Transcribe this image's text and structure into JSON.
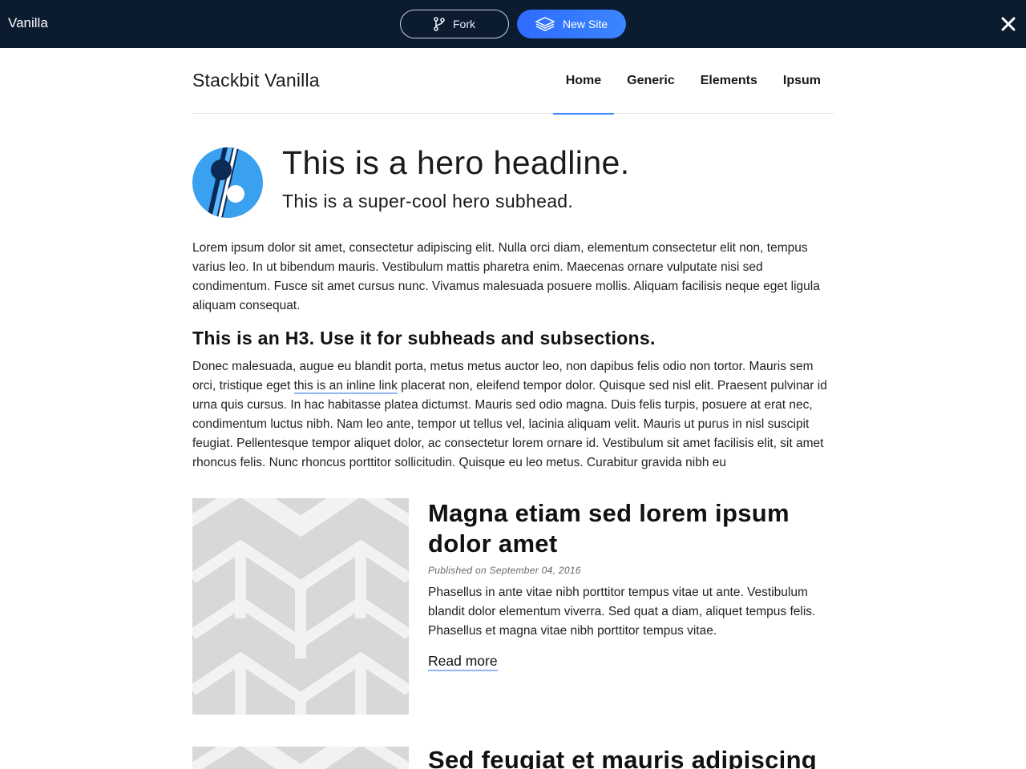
{
  "topbar": {
    "title": "Vanilla",
    "fork_label": "Fork",
    "new_site_label": "New Site"
  },
  "site": {
    "logo_text": "Stackbit Vanilla",
    "nav": [
      {
        "label": "Home",
        "active": true
      },
      {
        "label": "Generic",
        "active": false
      },
      {
        "label": "Elements",
        "active": false
      },
      {
        "label": "Ipsum",
        "active": false
      }
    ]
  },
  "hero": {
    "headline": "This is a hero headline.",
    "subhead": "This is a super-cool hero subhead."
  },
  "content": {
    "paragraph1": "Lorem ipsum dolor sit amet, consectetur adipiscing elit. Nulla orci diam, elementum consectetur elit non, tempus varius leo. In ut bibendum mauris. Vestibulum mattis pharetra enim. Maecenas ornare vulputate nisi sed condimentum. Fusce sit amet cursus nunc. Vivamus malesuada posuere mollis. Aliquam facilisis neque eget ligula aliquam consequat.",
    "h3": "This is an H3. Use it for subheads and subsections.",
    "paragraph2_before": "Donec malesuada, augue eu blandit porta, metus metus auctor leo, non dapibus felis odio non tortor. Mauris sem orci, tristique eget ",
    "paragraph2_link": "this is an inline link",
    "paragraph2_after": " placerat non, eleifend tempor dolor. Quisque sed nisl elit. Praesent pulvinar id urna quis cursus. In hac habitasse platea dictumst. Mauris sed odio magna. Duis felis turpis, posuere at erat nec, condimentum luctus nibh. Nam leo ante, tempor ut tellus vel, lacinia aliquam velit. Mauris ut purus in nisl suscipit feugiat. Pellentesque tempor aliquet dolor, ac consectetur lorem ornare id. Vestibulum sit amet facilisis elit, sit amet rhoncus felis. Nunc rhoncus porttitor sollicitudin. Quisque eu leo metus. Curabitur gravida nibh eu"
  },
  "posts": [
    {
      "title": "Magna etiam sed lorem ipsum dolor amet",
      "date": "Published on September 04, 2016",
      "excerpt": "Phasellus in ante vitae nibh porttitor tempus vitae ut ante. Vestibulum blandit dolor elementum viverra. Sed quat a diam, aliquet tempus felis. Phasellus et magna vitae nibh porttitor tempus vitae.",
      "read_more": "Read more"
    },
    {
      "title": "Sed feugiat et mauris adipiscing"
    }
  ],
  "colors": {
    "topbar_bg": "#0b1b30",
    "accent": "#3a86ff",
    "link_underline": "#8fb6ff"
  },
  "icons": {
    "fork": "git-fork-icon",
    "new_site": "stack-layers-icon",
    "close": "close-icon",
    "hero_logo": "stackbit-logo"
  }
}
